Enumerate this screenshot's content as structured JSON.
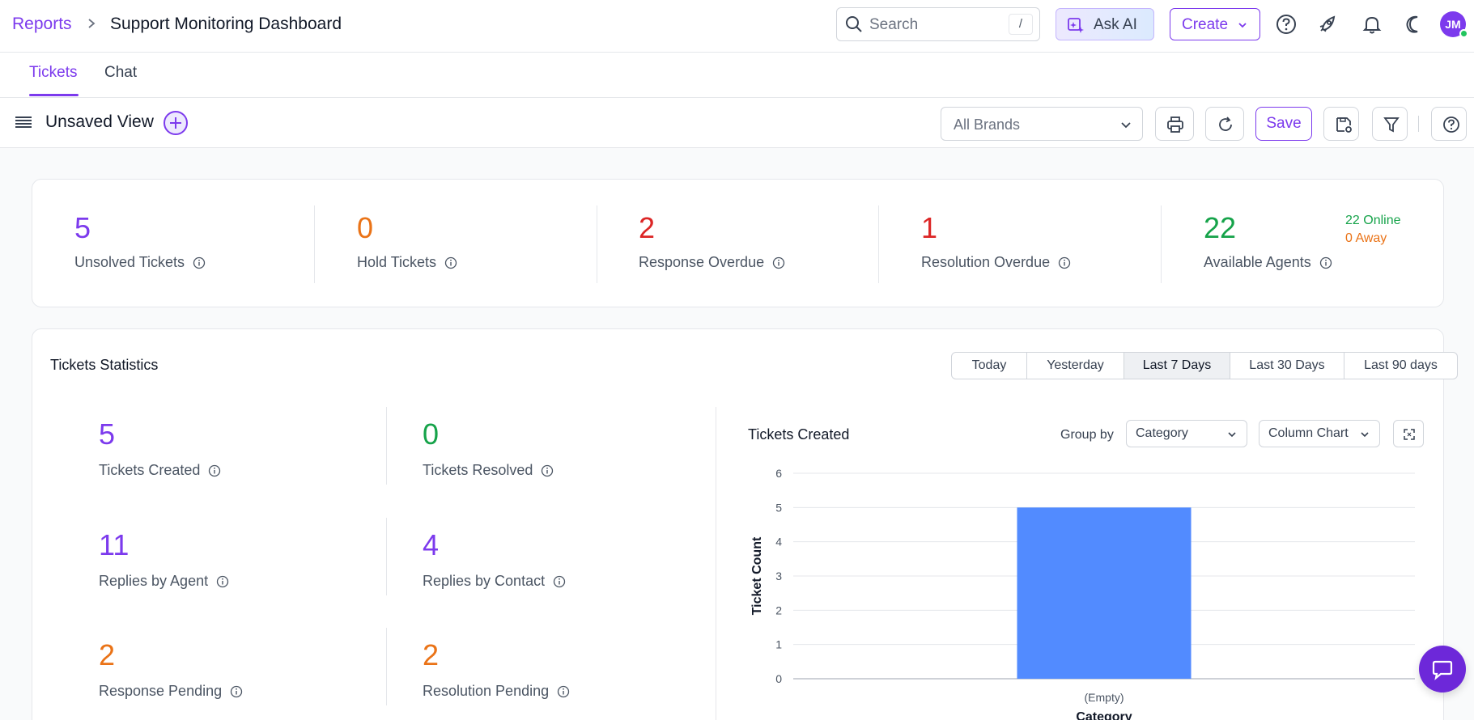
{
  "header": {
    "breadcrumb_root": "Reports",
    "page_title": "Support Monitoring Dashboard",
    "search_placeholder": "Search",
    "search_shortcut": "/",
    "ask_ai_label": "Ask AI",
    "create_label": "Create",
    "user_initials": "JM"
  },
  "tabs": [
    {
      "label": "Tickets",
      "active": true
    },
    {
      "label": "Chat",
      "active": false
    }
  ],
  "view": {
    "title": "Unsaved View",
    "brand_filter": "All Brands",
    "save_label": "Save"
  },
  "kpis": [
    {
      "value": "5",
      "label": "Unsolved Tickets",
      "color": "#7c3aed"
    },
    {
      "value": "0",
      "label": "Hold Tickets",
      "color": "#ea7317"
    },
    {
      "value": "2",
      "label": "Response Overdue",
      "color": "#dc2626"
    },
    {
      "value": "1",
      "label": "Resolution Overdue",
      "color": "#dc2626"
    },
    {
      "value": "22",
      "label": "Available Agents",
      "color": "#16a34a"
    }
  ],
  "agents_status": {
    "online": "22 Online",
    "away": "0 Away"
  },
  "stats": {
    "title": "Tickets Statistics",
    "ranges": [
      "Today",
      "Yesterday",
      "Last 7 Days",
      "Last 30 Days",
      "Last 90 days"
    ],
    "selected_range": "Last 7 Days",
    "items": [
      {
        "value": "5",
        "label": "Tickets Created",
        "color": "#7c3aed"
      },
      {
        "value": "0",
        "label": "Tickets Resolved",
        "color": "#16a34a"
      },
      {
        "value": "11",
        "label": "Replies by Agent",
        "color": "#7c3aed"
      },
      {
        "value": "4",
        "label": "Replies by Contact",
        "color": "#7c3aed"
      },
      {
        "value": "2",
        "label": "Response Pending",
        "color": "#ea7317"
      },
      {
        "value": "2",
        "label": "Resolution Pending",
        "color": "#ea7317"
      }
    ]
  },
  "chart_panel": {
    "title": "Tickets Created",
    "group_by_label": "Group by",
    "group_by_value": "Category",
    "chart_type_value": "Column Chart"
  },
  "colors": {
    "accent": "#7c3aed",
    "bar": "#528bff"
  },
  "chart_data": {
    "type": "bar",
    "categories": [
      "(Empty)"
    ],
    "values": [
      5
    ],
    "xlabel": "Category",
    "ylabel": "Ticket Count",
    "ylim": [
      0,
      6
    ],
    "yticks": [
      0,
      1,
      2,
      3,
      4,
      5,
      6
    ],
    "grid": true
  }
}
